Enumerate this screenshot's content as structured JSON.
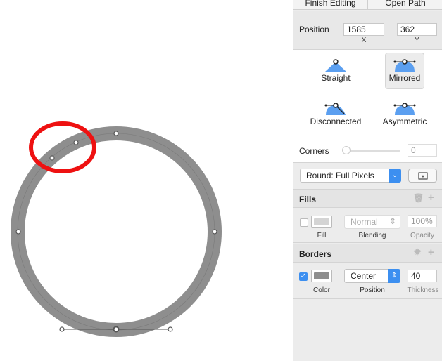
{
  "toolbar": {
    "finish_editing": "Finish Editing",
    "open_path": "Open Path"
  },
  "position": {
    "label": "Position",
    "x_value": "1585",
    "y_value": "362",
    "x_caption": "X",
    "y_caption": "Y"
  },
  "point_types": [
    {
      "label": "Straight",
      "selected": false
    },
    {
      "label": "Mirrored",
      "selected": true
    },
    {
      "label": "Disconnected",
      "selected": false
    },
    {
      "label": "Asymmetric",
      "selected": false
    }
  ],
  "corners": {
    "label": "Corners",
    "value": "0",
    "slider_fraction": 0
  },
  "rounding": {
    "selected": "Round: Full Pixels"
  },
  "fills": {
    "title": "Fills",
    "enabled": false,
    "color": "#d4d4d4",
    "fill_caption": "Fill",
    "blending": "Normal",
    "blending_caption": "Blending",
    "opacity": "100%",
    "opacity_caption": "Opacity"
  },
  "borders": {
    "title": "Borders",
    "enabled": true,
    "color": "#8e8e8e",
    "color_caption": "Color",
    "position": "Center",
    "position_caption": "Position",
    "thickness": "40",
    "thickness_caption": "Thickness"
  },
  "colors": {
    "accent": "#3c8ff0",
    "ring": "#8e8e8e",
    "highlight": "#ee1111"
  }
}
